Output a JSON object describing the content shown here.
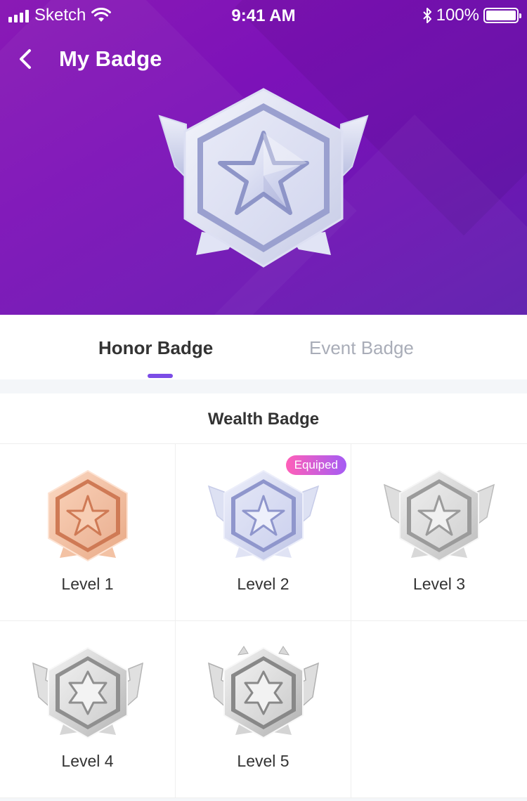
{
  "status_bar": {
    "carrier": "Sketch",
    "time": "9:41 AM",
    "battery": "100%"
  },
  "nav": {
    "title": "My Badge"
  },
  "tabs": [
    {
      "label": "Honor Badge",
      "active": true
    },
    {
      "label": "Event Badge",
      "active": false
    }
  ],
  "section": {
    "title": "Wealth Badge"
  },
  "badges": [
    {
      "label": "Level 1",
      "tier": "bronze",
      "equipped": false
    },
    {
      "label": "Level 2",
      "tier": "silver-blue",
      "equipped": true,
      "equip_label": "Equiped"
    },
    {
      "label": "Level 3",
      "tier": "silver",
      "equipped": false
    },
    {
      "label": "Level 4",
      "tier": "silver",
      "equipped": false
    },
    {
      "label": "Level 5",
      "tier": "silver",
      "equipped": false
    }
  ],
  "colors": {
    "header_gradient": [
      "#8a1ab5",
      "#5f1fae"
    ],
    "accent": "#7b4ce6",
    "equip_gradient": [
      "#ff5fb8",
      "#a55cf4"
    ]
  },
  "icons": {
    "back": "chevron-left-icon",
    "wifi": "wifi-icon",
    "bluetooth": "bluetooth-icon",
    "battery": "battery-icon"
  }
}
